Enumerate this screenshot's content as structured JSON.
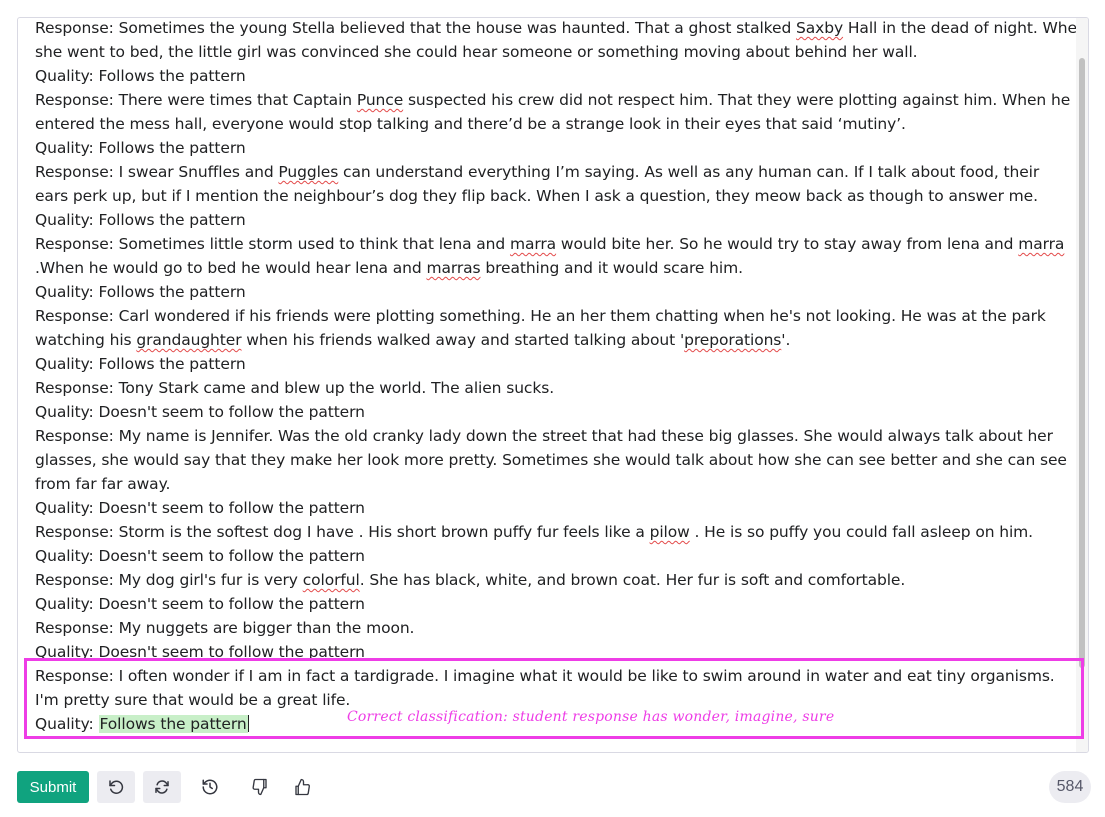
{
  "entries": [
    {
      "lines": [
        [
          {
            "t": "Response: Sometimes the young Stella believed that the house was haunted. That a ghost stalked "
          },
          {
            "t": "Saxby",
            "spell": true
          },
          {
            "t": " Hall in the dead of night. When"
          }
        ],
        [
          {
            "t": " she went to bed, the little girl was convinced she could hear someone or something moving about behind her wall."
          }
        ],
        [
          {
            "t": "Quality: Follows the pattern"
          }
        ]
      ]
    },
    {
      "lines": [
        [
          {
            "t": "Response: There were times that Captain "
          },
          {
            "t": "Punce",
            "spell": true
          },
          {
            "t": " suspected his crew did not respect him. That they were plotting against him. When he"
          }
        ],
        [
          {
            "t": "entered the mess hall, everyone would stop talking and there’d be a strange look in their eyes that said ‘mutiny’."
          }
        ],
        [
          {
            "t": "Quality: Follows the pattern"
          }
        ]
      ]
    },
    {
      "lines": [
        [
          {
            "t": "Response: I swear Snuffles and "
          },
          {
            "t": "Puggles",
            "spell": true
          },
          {
            "t": " can understand everything I’m saying. As well as any human can. If I talk about food, their"
          }
        ],
        [
          {
            "t": "ears perk up, but if I mention the neighbour’s dog they flip back. When I ask a question, they meow back as though to answer me."
          }
        ],
        [
          {
            "t": "Quality: Follows the pattern"
          }
        ]
      ]
    },
    {
      "lines": [
        [
          {
            "t": "Response: Sometimes little storm used to think that lena and "
          },
          {
            "t": "marra",
            "spell": true
          },
          {
            "t": " would bite her. So he would try to stay away from lena and "
          },
          {
            "t": "marra",
            "spell": true
          }
        ],
        [
          {
            "t": ".When he would go to bed he would hear lena and "
          },
          {
            "t": "marras",
            "spell": true
          },
          {
            "t": " breathing and it would scare him."
          }
        ],
        [
          {
            "t": "Quality: Follows the pattern"
          }
        ]
      ]
    },
    {
      "lines": [
        [
          {
            "t": "Response: Carl wondered if his friends were plotting something. He an her them chatting when he's not looking. He was at the park"
          }
        ],
        [
          {
            "t": "watching his "
          },
          {
            "t": "grandaughter",
            "spell": true
          },
          {
            "t": " when his friends walked away and started talking about '"
          },
          {
            "t": "preporations",
            "spell": true
          },
          {
            "t": "'."
          }
        ],
        [
          {
            "t": "Quality: Follows the pattern"
          }
        ]
      ]
    },
    {
      "lines": [
        [
          {
            "t": "Response: Tony Stark came and blew up the world. The alien sucks."
          }
        ],
        [
          {
            "t": "Quality: Doesn't seem to follow the pattern"
          }
        ]
      ]
    },
    {
      "lines": [
        [
          {
            "t": "Response: My name is Jennifer. Was the old cranky lady down the street that had these big glasses. She would always talk about her"
          }
        ],
        [
          {
            "t": "glasses, she would say that they make her look more pretty. Sometimes she would talk about how she can see better and she can see"
          }
        ],
        [
          {
            "t": "from far far away."
          }
        ],
        [
          {
            "t": "Quality: Doesn't seem to follow the pattern"
          }
        ]
      ]
    },
    {
      "lines": [
        [
          {
            "t": "Response: Storm is the softest dog I have . His short brown puffy fur feels like a "
          },
          {
            "t": "pilow",
            "spell": true
          },
          {
            "t": " . He is so puffy you could fall asleep on him."
          }
        ],
        [
          {
            "t": "Quality: Doesn't seem to follow the pattern"
          }
        ]
      ]
    },
    {
      "lines": [
        [
          {
            "t": "Response: My dog girl's fur is very "
          },
          {
            "t": "colorful",
            "spell": true
          },
          {
            "t": ". She has black, white, and brown coat. Her fur is soft and comfortable."
          }
        ],
        [
          {
            "t": "Quality: Doesn't seem to follow the pattern"
          }
        ]
      ]
    },
    {
      "lines": [
        [
          {
            "t": "Response: My nuggets are bigger than the moon."
          }
        ],
        [
          {
            "t": "Quality: Doesn't seem to follow the pattern"
          }
        ]
      ]
    }
  ],
  "final_entry": {
    "response_line1": "Response: I often wonder if I am in fact a tardigrade. I imagine what it would be like to swim around in water and eat tiny organisms.",
    "response_line2": "I'm pretty sure that would be a great life.",
    "quality_prefix": "Quality: ",
    "quality_completion": "Follows the pattern"
  },
  "annotation": "Correct classification: student response has wonder, imagine, sure",
  "toolbar": {
    "submit_label": "Submit",
    "icons": [
      "undo-icon",
      "regenerate-icon",
      "history-icon",
      "thumbs-down-icon",
      "thumbs-up-icon"
    ]
  },
  "token_count": "584",
  "colors": {
    "submit": "#10a37f",
    "highlight_box": "#ee3de6",
    "completion_highlight": "#c8efc8",
    "spellcheck": "#e34a4a"
  }
}
